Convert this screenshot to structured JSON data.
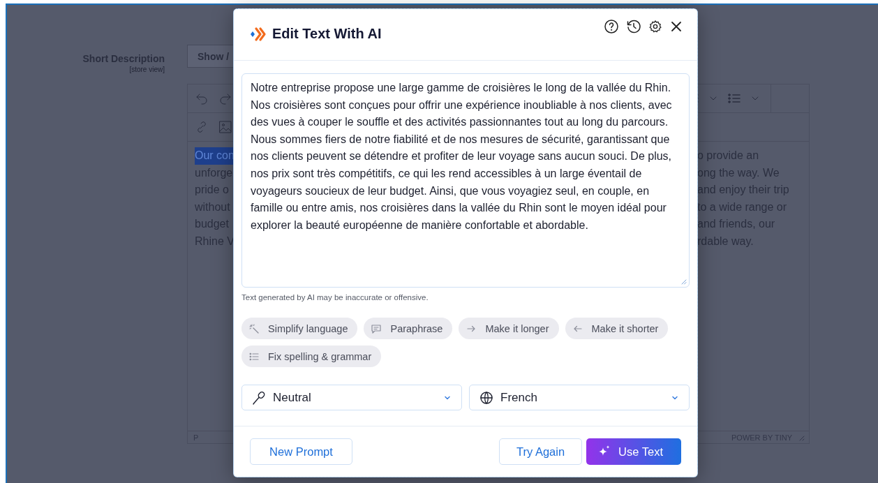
{
  "page": {
    "field_label": "Short Description",
    "field_scope": "[store view]",
    "show_button": "Show /"
  },
  "editor": {
    "left_lines": [
      {
        "text": "Our con",
        "selected": true
      },
      {
        "text": "unforge",
        "selected": false
      },
      {
        "text": "pride o",
        "selected": false
      },
      {
        "text": "without",
        "selected": false
      },
      {
        "text": "budget",
        "selected": false
      },
      {
        "text": "Rhine V",
        "selected": false
      }
    ],
    "right_lines": [
      "o provide an",
      "ong the way. We",
      "and enjoy their trip",
      "to a wide range or",
      "and friends, our",
      "rdable way."
    ],
    "status_path": "P",
    "status_brand": "POWER BY TINY"
  },
  "modal": {
    "title": "Edit Text With AI",
    "prompt_text": "Notre entreprise propose une large gamme de croisières le long de la vallée du Rhin. Nos croisières sont conçues pour offrir une expérience inoubliable à nos clients, avec des vues à couper le souffle et des activités passionnantes tout au long du parcours. Nous sommes fiers de notre fiabilité et de nos mesures de sécurité, garantissant que nos clients peuvent se détendre et profiter de leur voyage sans aucun souci. De plus, nos prix sont très compétitifs, ce qui les rend accessibles à un large éventail de voyageurs soucieux de leur budget. Ainsi, que vous voyagiez seul, en couple, en famille ou entre amis, nos croisières dans la vallée du Rhin sont le moyen idéal pour explorer la beauté européenne de manière confortable et abordable.",
    "disclaimer": "Text generated by AI may be inaccurate or offensive.",
    "actions": [
      {
        "kind": "wand",
        "label": "Simplify language"
      },
      {
        "kind": "speech",
        "label": "Paraphrase"
      },
      {
        "kind": "right",
        "label": "Make it longer"
      },
      {
        "kind": "left",
        "label": "Make it shorter"
      },
      {
        "kind": "list",
        "label": "Fix spelling & grammar"
      }
    ],
    "selects": [
      {
        "kind": "tone",
        "value": "Neutral"
      },
      {
        "kind": "language",
        "value": "French"
      }
    ],
    "new_prompt": "New Prompt",
    "try_again": "Try Again",
    "use_text": "Use Text"
  }
}
